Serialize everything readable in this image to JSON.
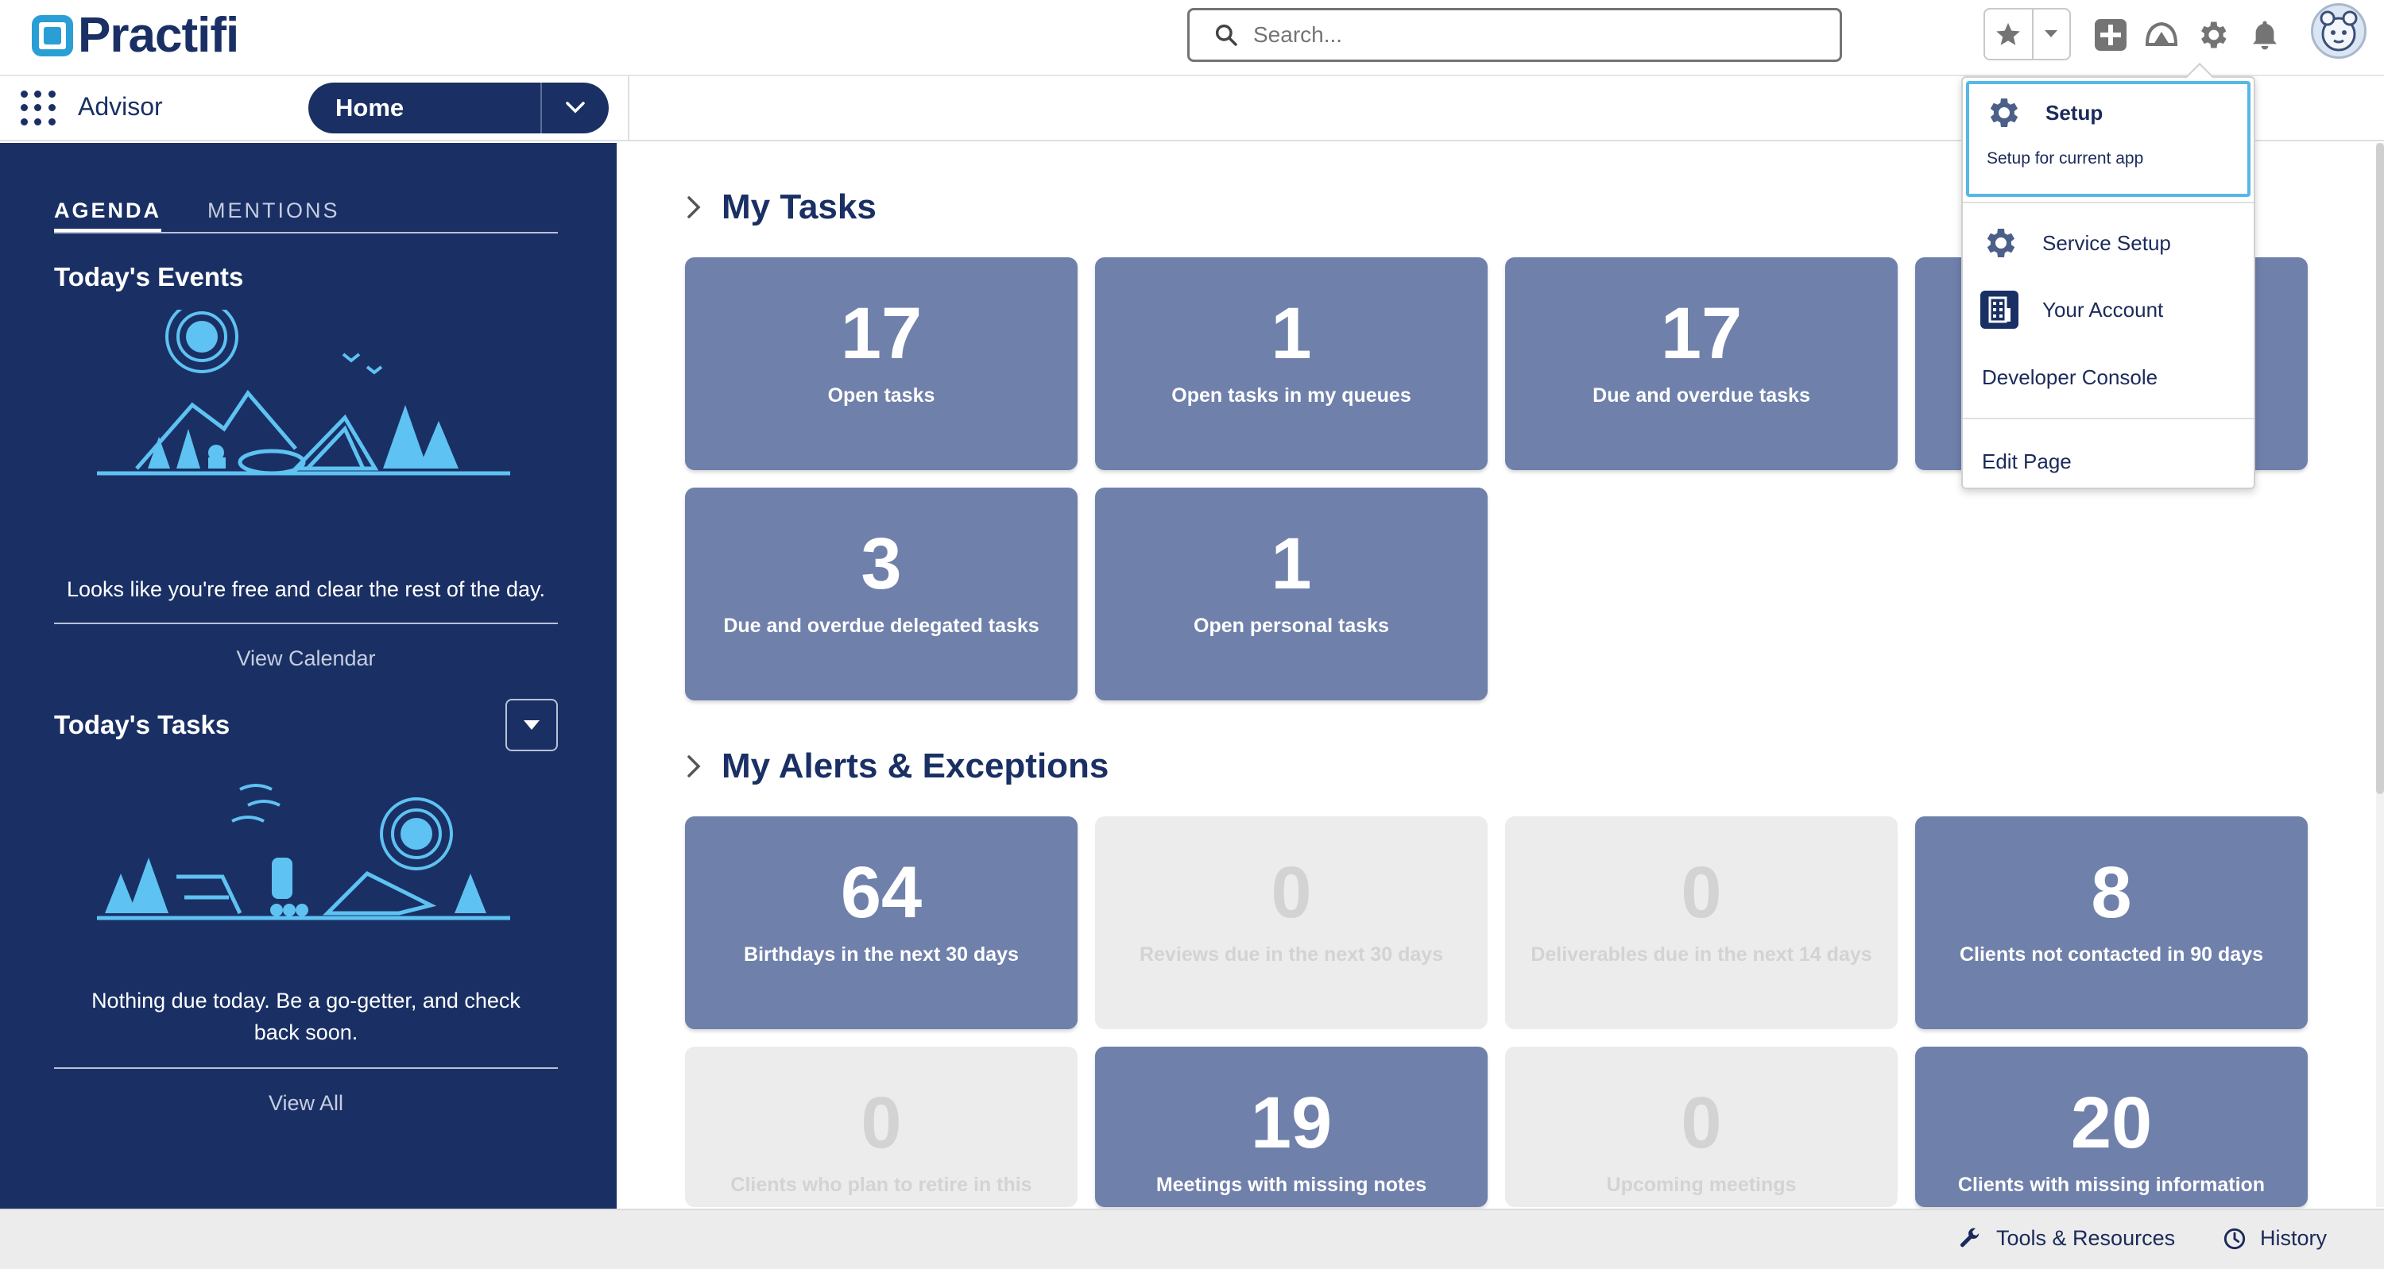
{
  "brand": {
    "name": "Practifi"
  },
  "header": {
    "search_placeholder": "Search...",
    "icons": [
      "star-icon",
      "chevron-down-icon",
      "add-icon",
      "trailhead-icon",
      "gear-icon",
      "bell-icon",
      "avatar"
    ]
  },
  "app_nav": {
    "app_name": "Advisor",
    "current_tab": "Home"
  },
  "sidebar": {
    "tabs": [
      {
        "label": "AGENDA",
        "active": true
      },
      {
        "label": "MENTIONS",
        "active": false
      }
    ],
    "events": {
      "heading": "Today's Events",
      "empty_message": "Looks like you're free and clear the rest of the day.",
      "link": "View Calendar"
    },
    "tasks": {
      "heading": "Today's Tasks",
      "empty_message": "Nothing due today. Be a go-getter, and check back soon.",
      "link": "View All"
    }
  },
  "my_tasks": {
    "title": "My Tasks",
    "tiles": [
      {
        "value": "17",
        "label": "Open tasks"
      },
      {
        "value": "1",
        "label": "Open tasks in my queues"
      },
      {
        "value": "17",
        "label": "Due and overdue tasks"
      },
      {
        "value": "",
        "label": ""
      },
      {
        "value": "3",
        "label": "Due and overdue delegated tasks"
      },
      {
        "value": "1",
        "label": "Open personal tasks"
      }
    ]
  },
  "alerts": {
    "title": "My Alerts & Exceptions",
    "tiles": [
      {
        "value": "64",
        "label": "Birthdays in the next 30 days",
        "muted": false
      },
      {
        "value": "0",
        "label": "Reviews due in the next 30 days",
        "muted": true
      },
      {
        "value": "0",
        "label": "Deliverables due in the next 14 days",
        "muted": true
      },
      {
        "value": "8",
        "label": "Clients not contacted in 90 days",
        "muted": false
      },
      {
        "value": "0",
        "label": "Clients who plan to retire in this",
        "muted": true
      },
      {
        "value": "19",
        "label": "Meetings with missing notes",
        "muted": false
      },
      {
        "value": "0",
        "label": "Upcoming meetings",
        "muted": true
      },
      {
        "value": "20",
        "label": "Clients with missing information",
        "muted": false
      }
    ]
  },
  "setup_menu": {
    "setup": {
      "label": "Setup",
      "sublabel": "Setup for current app"
    },
    "items": [
      "Service Setup",
      "Your Account",
      "Developer Console",
      "Edit Page"
    ]
  },
  "utility_bar": {
    "tools": "Tools & Resources",
    "history": "History"
  },
  "colors": {
    "navy": "#1a3064",
    "tile": "#6f80ab",
    "tile_muted": "#ececec",
    "accent": "#57b7e6",
    "illustration": "#5ec2f2"
  }
}
